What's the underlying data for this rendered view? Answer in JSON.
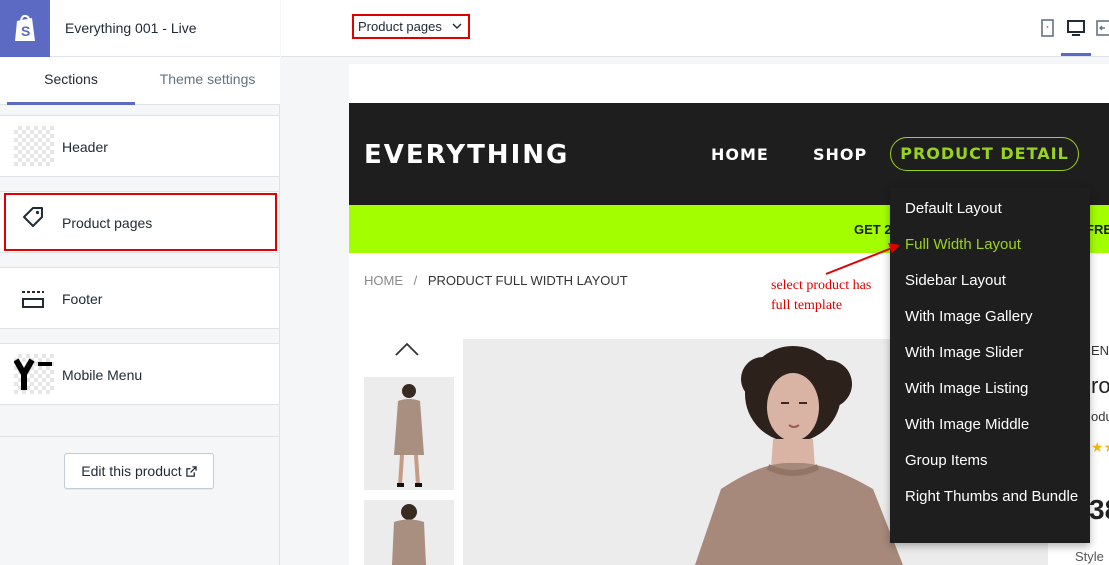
{
  "store": {
    "name": "Everything 001 - Live"
  },
  "tabs": [
    {
      "label": "Sections"
    },
    {
      "label": "Theme settings"
    }
  ],
  "sections": [
    {
      "label": "Header",
      "icon": "header-thumbnail-icon"
    },
    {
      "label": "Product pages",
      "icon": "tag-icon"
    },
    {
      "label": "Footer",
      "icon": "footer-icon"
    },
    {
      "label": "Mobile Menu",
      "icon": "mobile-menu-thumbnail-icon"
    }
  ],
  "edit_button": {
    "label": "Edit this product"
  },
  "topbar": {
    "page_select": "Product pages"
  },
  "preview": {
    "brand": "EVERYTHING",
    "nav": [
      "HOME",
      "SHOP",
      "PRODUCT DETAIL"
    ],
    "promo_left": "GET 2",
    "promo_right": "FRE",
    "breadcrumb": {
      "home": "HOME",
      "sep": "/",
      "current": "PRODUCT FULL WIDTH LAYOUT"
    },
    "right_peek": {
      "line1": "END",
      "line2": "ro",
      "line3": "odu",
      "price": "38",
      "style": "Style"
    }
  },
  "dropdown": {
    "items": [
      {
        "label": "Default Layout"
      },
      {
        "label": "Full Width Layout"
      },
      {
        "label": "Sidebar Layout"
      },
      {
        "label": "With Image Gallery"
      },
      {
        "label": "With Image Slider"
      },
      {
        "label": "With Image Listing"
      },
      {
        "label": "With Image Middle"
      },
      {
        "label": "Group Items"
      },
      {
        "label": "Right Thumbs and Bundle"
      }
    ],
    "active_index": 1
  },
  "annotation": {
    "line1": "select product has",
    "line2": "full template"
  },
  "colors": {
    "accent": "#5c6ac4",
    "highlight": "#e00000",
    "lime": "#a3ff00",
    "nav_green": "#9ad31e",
    "dark": "#1e1e1e"
  }
}
